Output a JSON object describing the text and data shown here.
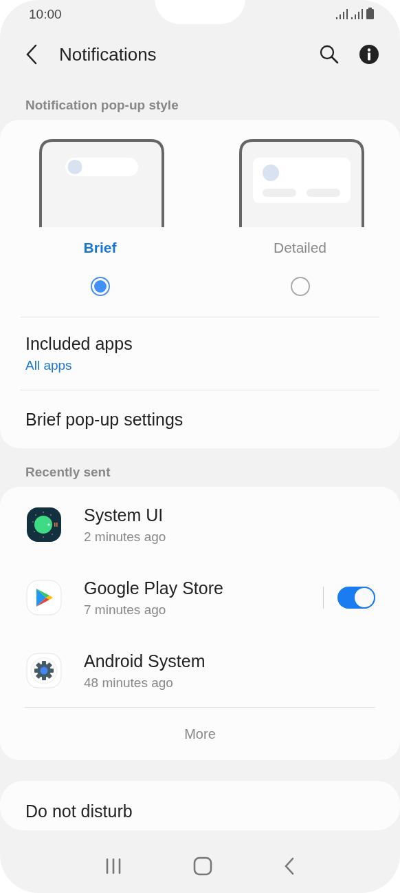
{
  "status_bar": {
    "time": "10:00"
  },
  "header": {
    "title": "Notifications"
  },
  "popup_style": {
    "label": "Notification pop-up style",
    "options": [
      {
        "kind": "brief",
        "label": "Brief",
        "selected": true
      },
      {
        "kind": "detailed",
        "label": "Detailed",
        "selected": false
      }
    ]
  },
  "settings": [
    {
      "title": "Included apps",
      "subtitle": "All apps"
    },
    {
      "title": "Brief pop-up settings"
    }
  ],
  "recently_sent": {
    "label": "Recently sent",
    "apps": [
      {
        "kind": "system-ui",
        "name": "System UI",
        "time": "2 minutes ago"
      },
      {
        "kind": "play-store",
        "name": "Google Play Store",
        "time": "7 minutes ago",
        "toggle": {
          "on": true
        }
      },
      {
        "kind": "android-system",
        "name": "Android System",
        "time": "48 minutes ago"
      }
    ],
    "more": "More"
  },
  "do_not_disturb": {
    "title": "Do not disturb"
  }
}
